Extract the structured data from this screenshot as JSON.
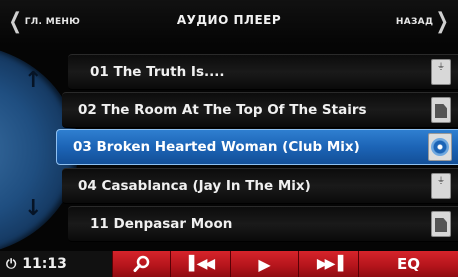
{
  "header": {
    "menu_label": "ГЛ. МЕНЮ",
    "title": "АУДИО ПЛЕЕР",
    "back_label": "НАЗАД"
  },
  "tracks": [
    {
      "label": "01 The Truth Is....",
      "source_icon": "usb-icon",
      "selected": false
    },
    {
      "label": "02 The Room At The Top Of The Stairs",
      "source_icon": "sd-card-icon",
      "selected": false
    },
    {
      "label": "03 Broken Hearted Woman (Club Mix)",
      "source_icon": "cd-icon",
      "selected": true
    },
    {
      "label": "04 Casablanca (Jay In The Mix)",
      "source_icon": "usb-icon",
      "selected": false
    },
    {
      "label": "11 Denpasar Moon",
      "source_icon": "sd-card-icon",
      "selected": false
    }
  ],
  "footer": {
    "clock": "11:13",
    "eq_label": "EQ"
  },
  "colors": {
    "selected": "#1c64b6",
    "button_red": "#c41a21",
    "dial_blue": "#1f4e80"
  }
}
